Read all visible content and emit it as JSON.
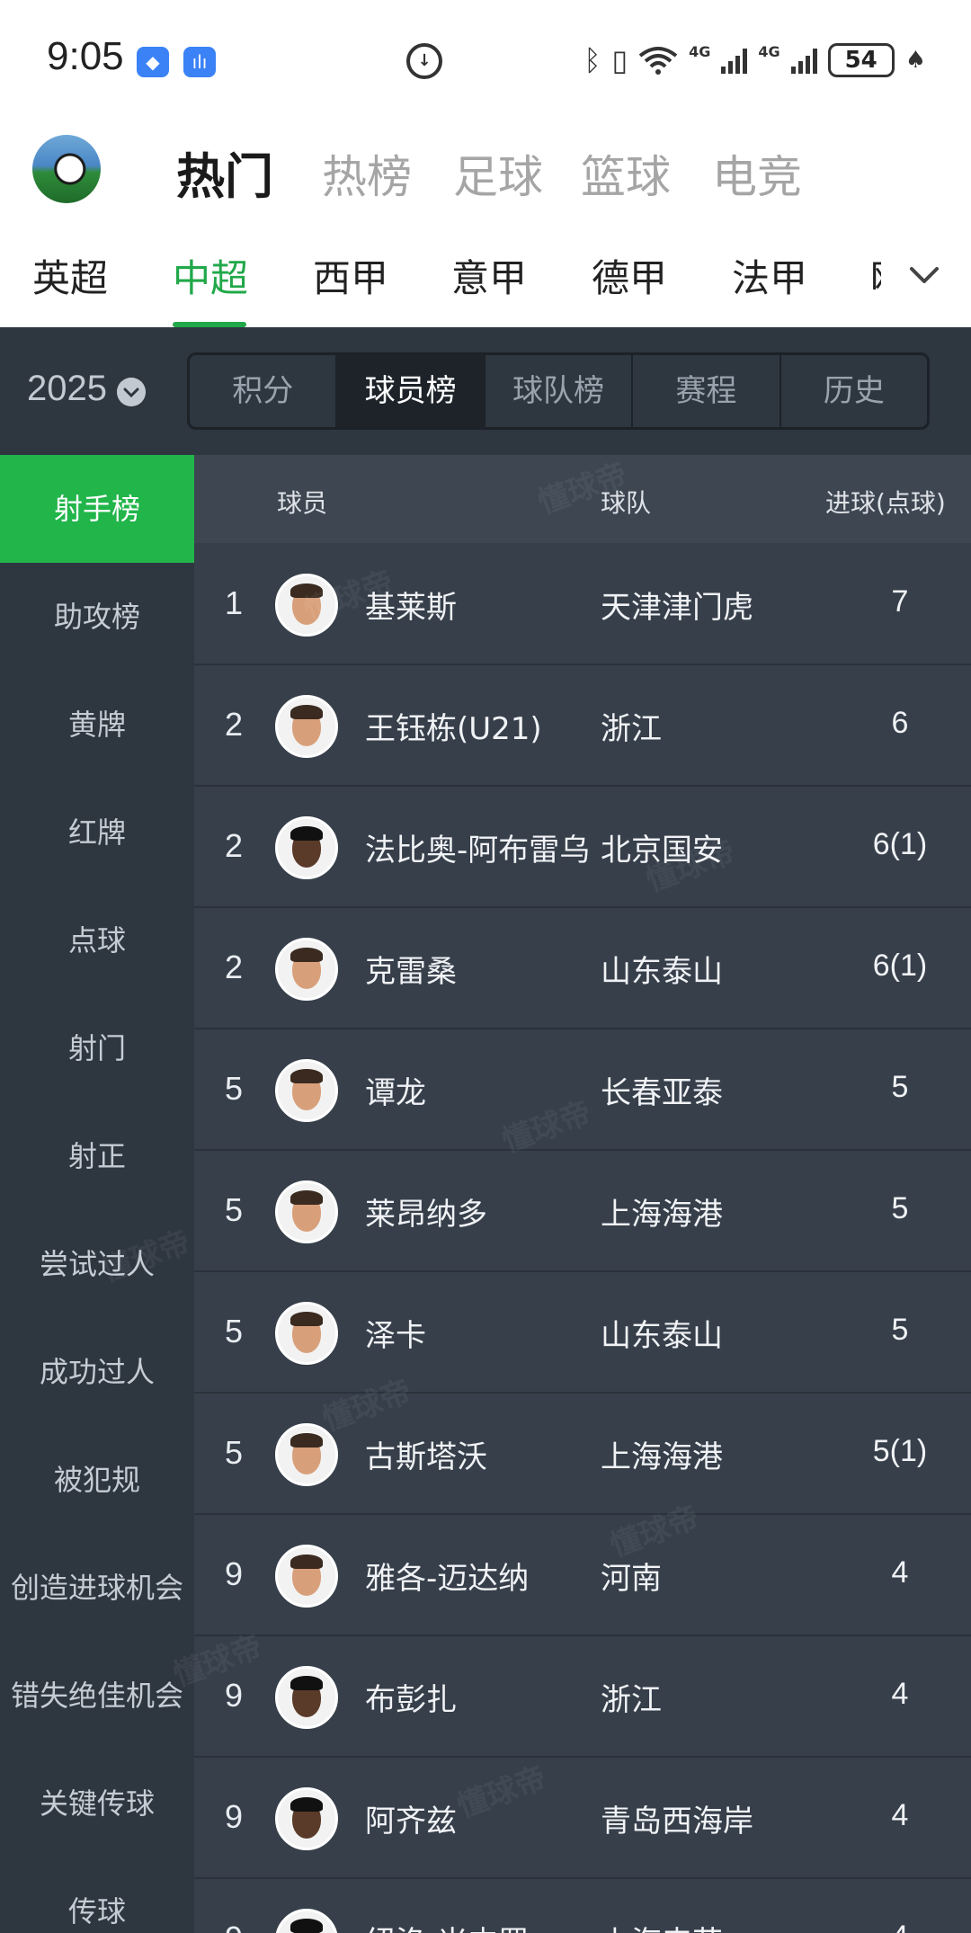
{
  "status_bar": {
    "time": "9:05",
    "network_1": "4G",
    "network_2": "4G",
    "battery": "54",
    "icons": [
      "assistant-app-icon",
      "voice-recorder-icon",
      "data-saver-icon",
      "bluetooth-icon",
      "vibrate-icon",
      "wifi-icon",
      "signal-icon",
      "battery-icon",
      "leaf-icon"
    ]
  },
  "top_nav": {
    "tabs": [
      {
        "label": "热门",
        "active": true
      },
      {
        "label": "热榜",
        "active": false
      },
      {
        "label": "足球",
        "active": false
      },
      {
        "label": "篮球",
        "active": false
      },
      {
        "label": "电竞",
        "active": false
      }
    ]
  },
  "league_tabs": {
    "items": [
      {
        "label": "英超",
        "active": false
      },
      {
        "label": "中超",
        "active": true
      },
      {
        "label": "西甲",
        "active": false
      },
      {
        "label": "意甲",
        "active": false
      },
      {
        "label": "德甲",
        "active": false
      },
      {
        "label": "法甲",
        "active": false
      }
    ],
    "accent_color": "#21a84a"
  },
  "filter": {
    "season": "2025",
    "segments": [
      {
        "label": "积分",
        "active": false
      },
      {
        "label": "球员榜",
        "active": true
      },
      {
        "label": "球队榜",
        "active": false
      },
      {
        "label": "赛程",
        "active": false
      },
      {
        "label": "历史",
        "active": false
      }
    ]
  },
  "sidebar": {
    "items": [
      {
        "label": "射手榜",
        "active": true
      },
      {
        "label": "助攻榜",
        "active": false
      },
      {
        "label": "黄牌",
        "active": false
      },
      {
        "label": "红牌",
        "active": false
      },
      {
        "label": "点球",
        "active": false
      },
      {
        "label": "射门",
        "active": false
      },
      {
        "label": "射正",
        "active": false
      },
      {
        "label": "尝试过人",
        "active": false
      },
      {
        "label": "成功过人",
        "active": false
      },
      {
        "label": "被犯规",
        "active": false
      },
      {
        "label": "创造进球机会",
        "active": false
      },
      {
        "label": "错失绝佳机会",
        "active": false
      },
      {
        "label": "关键传球",
        "active": false
      },
      {
        "label": "传球",
        "active": false
      }
    ],
    "active_color": "#21b54a"
  },
  "table": {
    "headers": {
      "player": "球员",
      "team": "球队",
      "goals": "进球(点球)"
    },
    "rows": [
      {
        "rank": "1",
        "name": "基莱斯",
        "team": "天津津门虎",
        "goals": "7"
      },
      {
        "rank": "2",
        "name": "王钰栋(U21)",
        "team": "浙江",
        "goals": "6"
      },
      {
        "rank": "2",
        "name": "法比奥-阿布雷乌",
        "team": "北京国安",
        "goals": "6(1)"
      },
      {
        "rank": "2",
        "name": "克雷桑",
        "team": "山东泰山",
        "goals": "6(1)"
      },
      {
        "rank": "5",
        "name": "谭龙",
        "team": "长春亚泰",
        "goals": "5"
      },
      {
        "rank": "5",
        "name": "莱昂纳多",
        "team": "上海海港",
        "goals": "5"
      },
      {
        "rank": "5",
        "name": "泽卡",
        "team": "山东泰山",
        "goals": "5"
      },
      {
        "rank": "5",
        "name": "古斯塔沃",
        "team": "上海海港",
        "goals": "5(1)"
      },
      {
        "rank": "9",
        "name": "雅各-迈达纳",
        "team": "河南",
        "goals": "4"
      },
      {
        "rank": "9",
        "name": "布彭扎",
        "team": "浙江",
        "goals": "4"
      },
      {
        "rank": "9",
        "name": "阿齐兹",
        "team": "青岛西海岸",
        "goals": "4"
      },
      {
        "rank": "9",
        "name": "纽洛-米内罗",
        "team": "上海申花",
        "goals": "4"
      }
    ]
  },
  "watermark": "懂球帝"
}
